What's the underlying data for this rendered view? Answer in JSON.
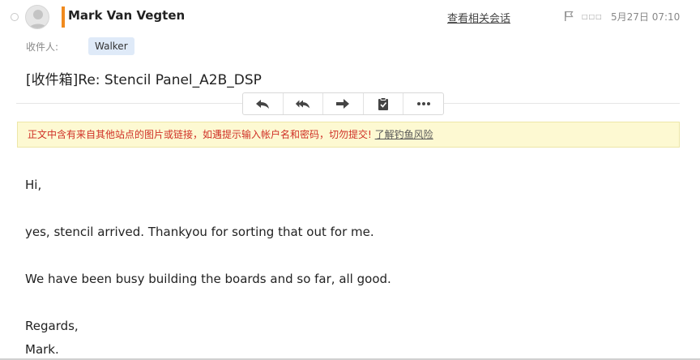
{
  "header": {
    "sender_name": "Mark Van Vegten",
    "related_link": "查看相关会话",
    "status_squares": "□□□",
    "date": "5月27日 07:10",
    "accent_color": "#f08a1e"
  },
  "recipients": {
    "label": "收件人:",
    "items": [
      "Walker"
    ]
  },
  "subject": "[收件箱]Re: Stencil Panel_A2B_DSP",
  "toolbar": {
    "icons": [
      "reply-icon",
      "reply-all-icon",
      "forward-icon",
      "clipboard-icon",
      "more-icon"
    ]
  },
  "warning": {
    "text": "正文中含有来自其他站点的图片或链接，如遇提示输入帐户名和密码，切勿提交! ",
    "link": "了解钓鱼风险",
    "text_color": "#d03026",
    "background": "#fdf9d2"
  },
  "body": {
    "lines": [
      "Hi,",
      "yes, stencil arrived. Thankyou for sorting that out for me.",
      "We have been busy building the boards and so far, all good.",
      "Regards,",
      "Mark."
    ]
  }
}
